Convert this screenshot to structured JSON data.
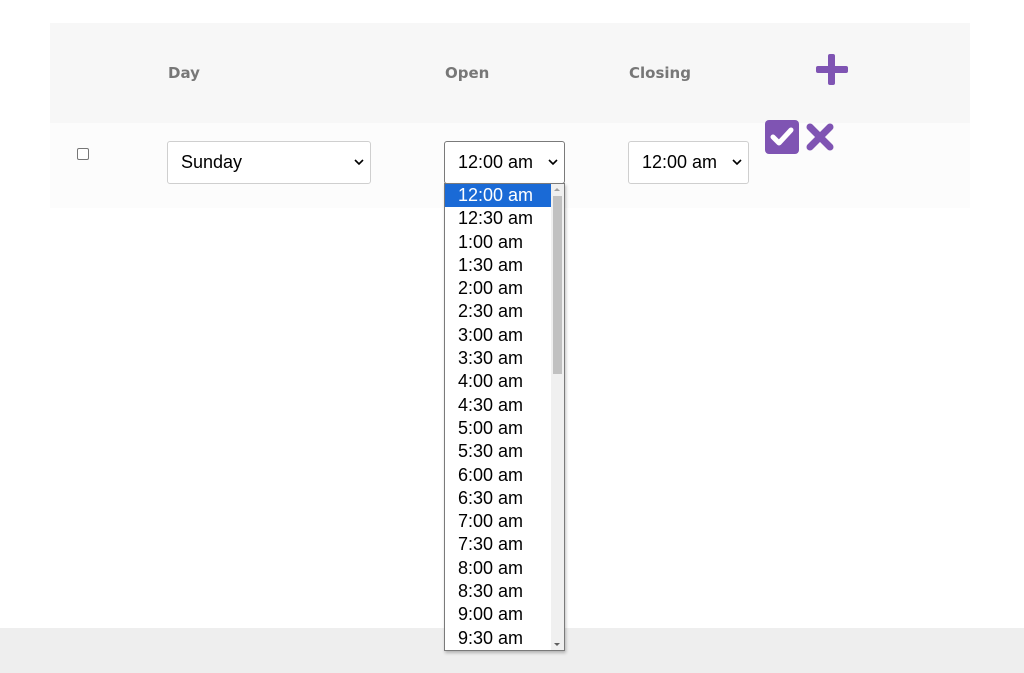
{
  "table": {
    "headers": {
      "day": "Day",
      "open": "Open",
      "closing": "Closing"
    },
    "row": {
      "checked": false,
      "day_value": "Sunday",
      "open_value": "12:00 am",
      "closing_value": "12:00 am"
    }
  },
  "icons": {
    "add": "plus-icon",
    "confirm": "check-square-icon",
    "cancel": "x-icon"
  },
  "colors": {
    "accent": "#7f54b3",
    "selected_option": "#1a6ad6",
    "header_bg": "#f7f7f7",
    "footer_bg": "#eeeeee"
  },
  "dropdown": {
    "selected": "12:00 am",
    "options": [
      "12:00 am",
      "12:30 am",
      "1:00 am",
      "1:30 am",
      "2:00 am",
      "2:30 am",
      "3:00 am",
      "3:30 am",
      "4:00 am",
      "4:30 am",
      "5:00 am",
      "5:30 am",
      "6:00 am",
      "6:30 am",
      "7:00 am",
      "7:30 am",
      "8:00 am",
      "8:30 am",
      "9:00 am",
      "9:30 am"
    ]
  }
}
